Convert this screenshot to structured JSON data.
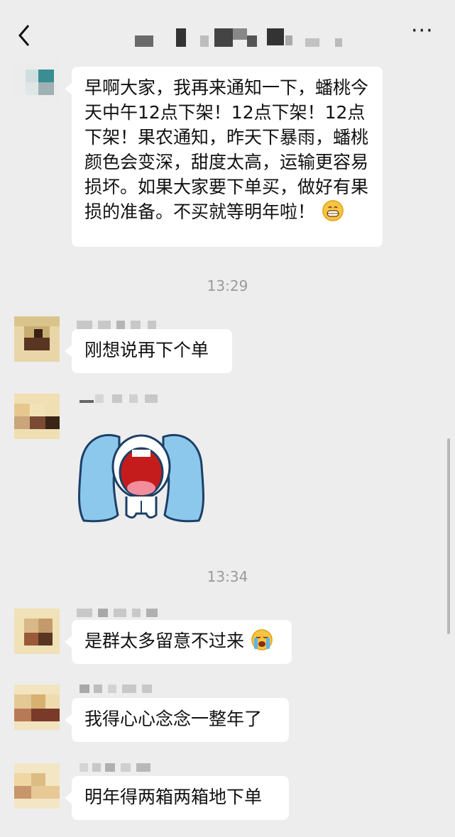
{
  "header": {
    "back_icon": "chevron-left-icon",
    "more_label": "···",
    "colors": {
      "background": "#ededed",
      "bubble": "#ffffff",
      "time": "#9a9a9a"
    }
  },
  "messages": [
    {
      "text": "早啊大家，我再来通知一下，蟠桃今天中午12点下架！12点下架！12点下架！果农通知，昨天下暴雨，蟠桃颜色会变深，甜度太高，运输更容易损坏。如果大家要下单买，做好有果损的准备。不买就等明年啦！",
      "emoji": "grinning-face-icon"
    },
    {
      "time": "13:29"
    },
    {
      "text": "刚想说再下个单"
    },
    {
      "sticker": "crying-cartoon-sticker"
    },
    {
      "time": "13:34"
    },
    {
      "text": "是群太多留意不过来",
      "emoji": "loudly-crying-face-icon"
    },
    {
      "text": "我得心心念念一整年了"
    },
    {
      "text": "明年得两箱两箱地下单"
    }
  ]
}
